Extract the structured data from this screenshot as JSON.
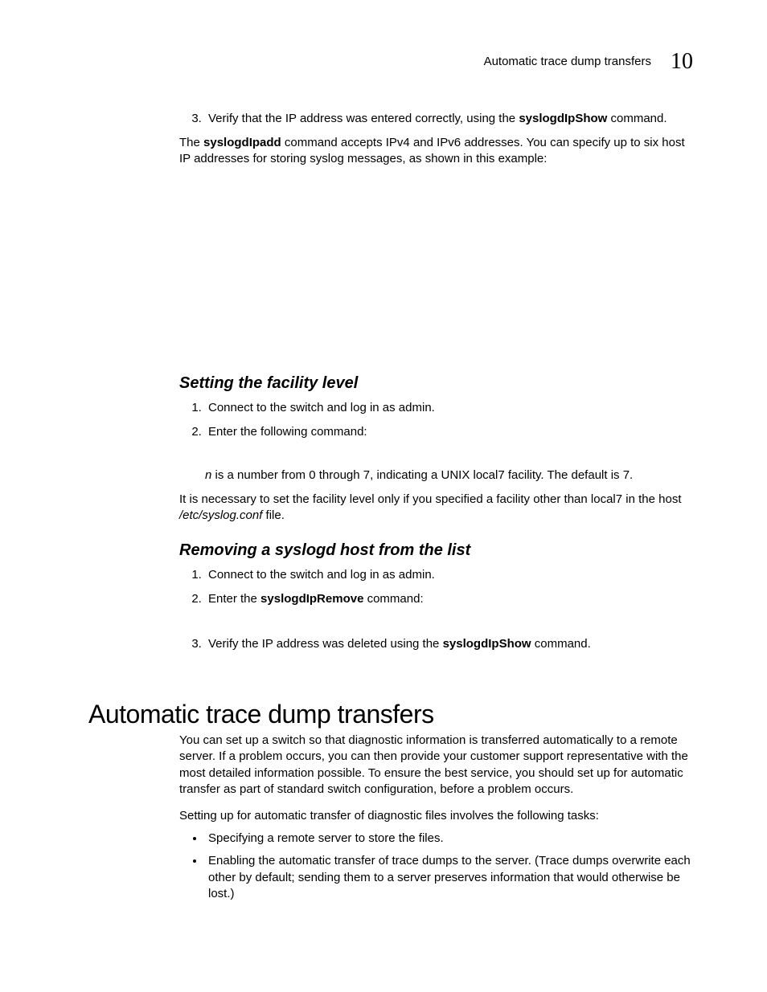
{
  "header": {
    "running_title": "Automatic trace dump transfers",
    "chapter_number": "10"
  },
  "step3": {
    "marker": "3.",
    "pre": "Verify that the IP address was entered correctly, using the ",
    "cmd": "syslogdIpShow",
    "post": " command."
  },
  "para_ipadd": {
    "pre": "The ",
    "cmd": "syslogdIpadd",
    "post": " command accepts IPv4 and IPv6 addresses. You can specify up to six host IP addresses for storing syslog messages, as shown in this example:"
  },
  "sec_facility": {
    "heading": "Setting the facility level",
    "s1": "Connect to the switch and log in as admin.",
    "s2": "Enter the following command:",
    "note_n_pre": "n",
    "note_n_post": " is a number from 0 through 7, indicating a UNIX local7 facility. The default is 7.",
    "p_pre": "It is necessary to set the facility level only if you specified a facility other than local7 in the host ",
    "p_file": "/etc/syslog.conf",
    "p_post": " file."
  },
  "sec_remove": {
    "heading": "Removing a syslogd host from the list",
    "s1": "Connect to the switch and log in as admin.",
    "s2_pre": "Enter the ",
    "s2_cmd": "syslogdIpRemove",
    "s2_post": " command:",
    "s3_pre": "Verify the IP address was deleted using the ",
    "s3_cmd": "syslogdIpShow",
    "s3_post": " command."
  },
  "sec_auto": {
    "heading": "Automatic trace dump transfers",
    "p1": "You can set up a switch so that diagnostic information is transferred automatically to a remote server. If a problem occurs, you can then provide your customer support representative with the most detailed information possible. To ensure the best service, you should set up for automatic transfer as part of standard switch configuration, before a problem occurs.",
    "p2": "Setting up for automatic transfer of diagnostic files involves the following tasks:",
    "b1": "Specifying a remote server to store the files.",
    "b2": "Enabling the automatic transfer of trace dumps to the server. (Trace dumps overwrite each other by default; sending them to a server preserves information that would otherwise be lost.)"
  }
}
